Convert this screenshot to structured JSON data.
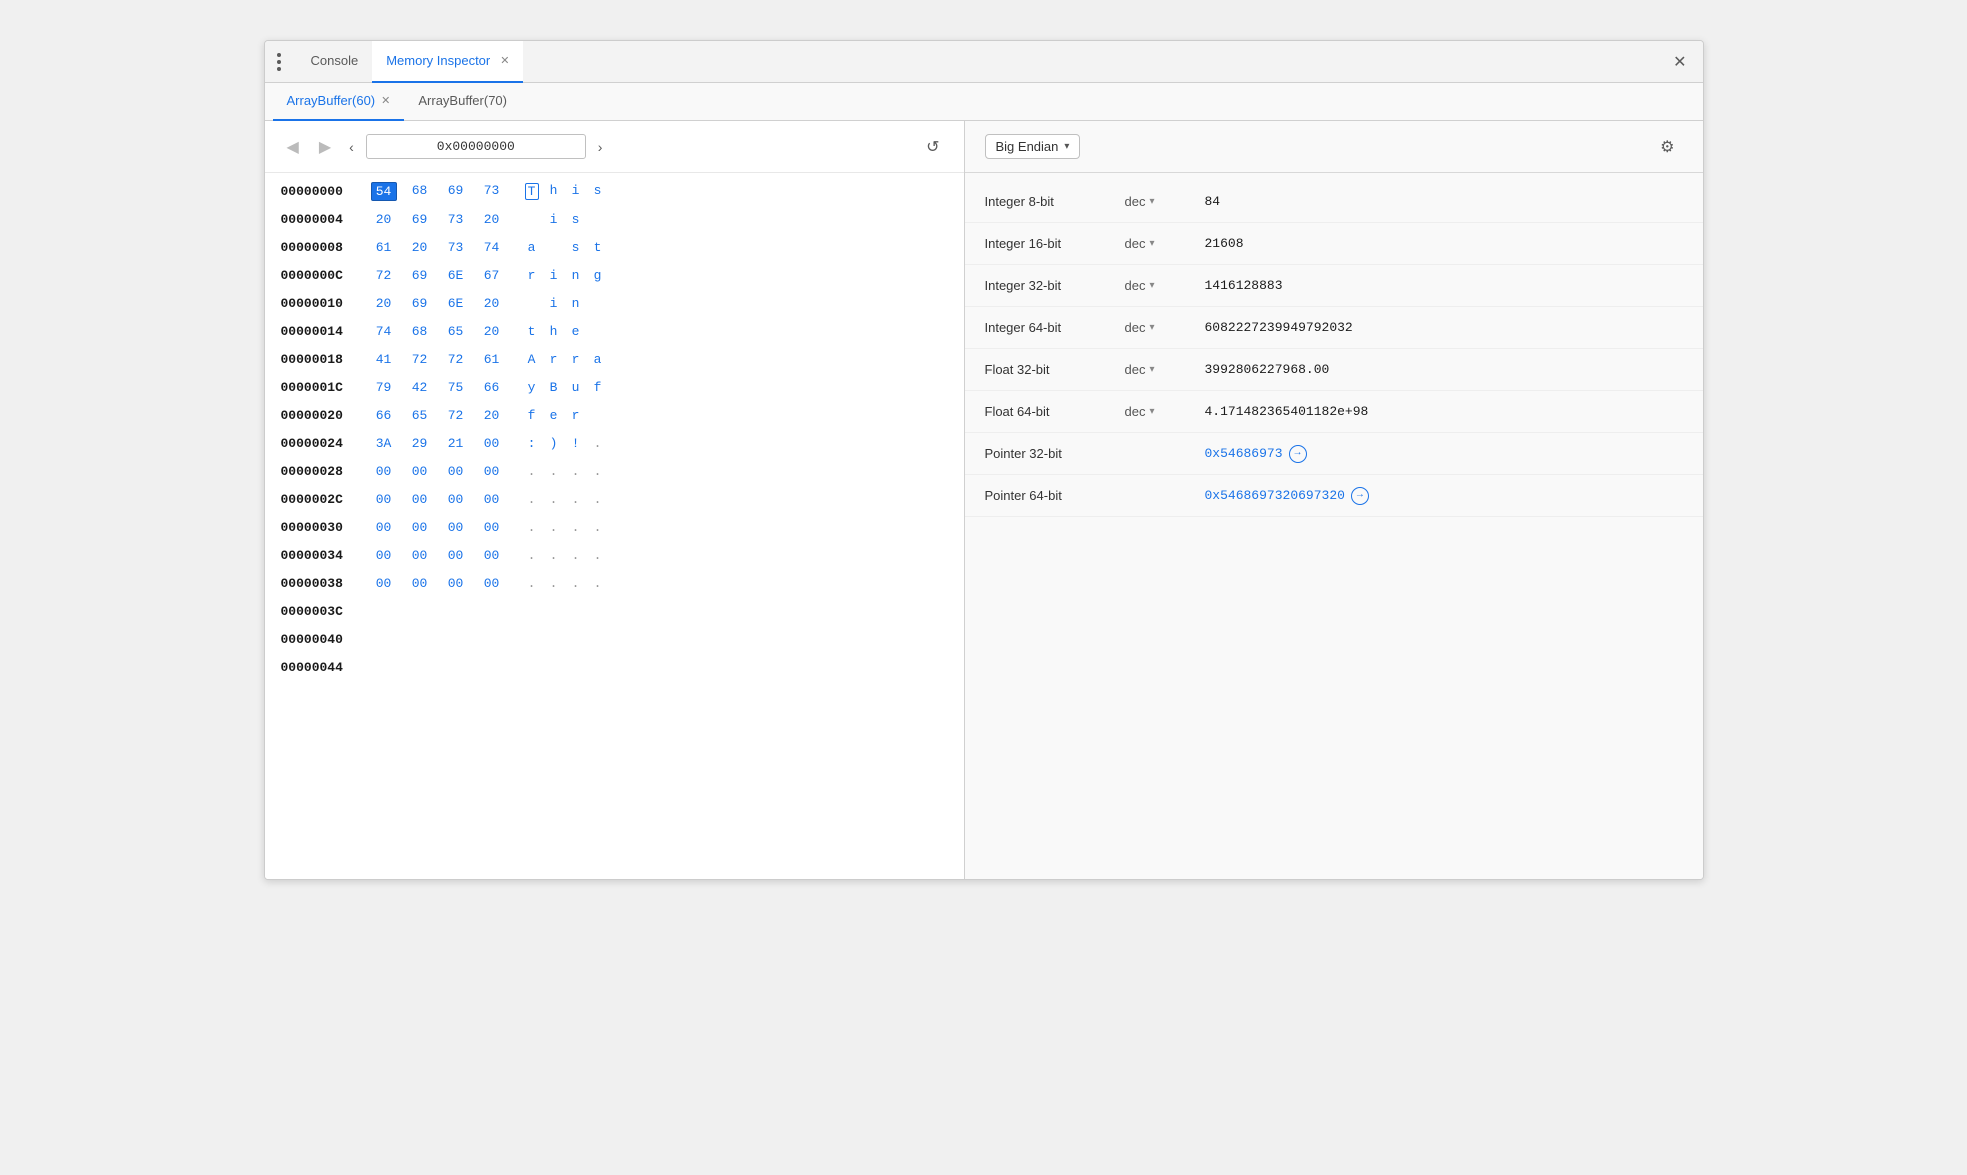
{
  "window": {
    "title": "Memory Inspector",
    "close_label": "✕"
  },
  "top_tabs": [
    {
      "id": "console",
      "label": "Console",
      "active": false,
      "closable": false
    },
    {
      "id": "memory-inspector",
      "label": "Memory Inspector",
      "active": true,
      "closable": true
    }
  ],
  "sub_tabs": [
    {
      "id": "arraybuffer-60",
      "label": "ArrayBuffer(60)",
      "active": true,
      "closable": true
    },
    {
      "id": "arraybuffer-70",
      "label": "ArrayBuffer(70)",
      "active": false,
      "closable": false
    }
  ],
  "nav": {
    "address": "0x00000000",
    "back_label": "◀",
    "forward_label": "▶",
    "left_arrow": "‹",
    "right_arrow": "›",
    "refresh_label": "↺"
  },
  "memory_rows": [
    {
      "addr": "00000000",
      "hex": [
        "54",
        "68",
        "69",
        "73"
      ],
      "ascii": [
        "T",
        "h",
        "i",
        "s"
      ],
      "selected_hex": 0,
      "selected_ascii": 0
    },
    {
      "addr": "00000004",
      "hex": [
        "20",
        "69",
        "73",
        "20"
      ],
      "ascii": [
        " ",
        "i",
        "s",
        " "
      ]
    },
    {
      "addr": "00000008",
      "hex": [
        "61",
        "20",
        "73",
        "74"
      ],
      "ascii": [
        "a",
        " ",
        "s",
        "t"
      ]
    },
    {
      "addr": "0000000C",
      "hex": [
        "72",
        "69",
        "6E",
        "67"
      ],
      "ascii": [
        "r",
        "i",
        "n",
        "g"
      ]
    },
    {
      "addr": "00000010",
      "hex": [
        "20",
        "69",
        "6E",
        "20"
      ],
      "ascii": [
        " ",
        "i",
        "n",
        " "
      ]
    },
    {
      "addr": "00000014",
      "hex": [
        "74",
        "68",
        "65",
        "20"
      ],
      "ascii": [
        "t",
        "h",
        "e",
        " "
      ]
    },
    {
      "addr": "00000018",
      "hex": [
        "41",
        "72",
        "72",
        "61"
      ],
      "ascii": [
        "A",
        "r",
        "r",
        "a"
      ]
    },
    {
      "addr": "0000001C",
      "hex": [
        "79",
        "42",
        "75",
        "66"
      ],
      "ascii": [
        "y",
        "B",
        "u",
        "f"
      ]
    },
    {
      "addr": "00000020",
      "hex": [
        "66",
        "65",
        "72",
        "20"
      ],
      "ascii": [
        "f",
        "e",
        "r",
        " "
      ]
    },
    {
      "addr": "00000024",
      "hex": [
        "3A",
        "29",
        "21",
        "00"
      ],
      "ascii": [
        ":",
        ")",
        "!",
        "."
      ]
    },
    {
      "addr": "00000028",
      "hex": [
        "00",
        "00",
        "00",
        "00"
      ],
      "ascii": [
        ".",
        ".",
        ".",
        "."
      ]
    },
    {
      "addr": "0000002C",
      "hex": [
        "00",
        "00",
        "00",
        "00"
      ],
      "ascii": [
        ".",
        ".",
        ".",
        "."
      ]
    },
    {
      "addr": "00000030",
      "hex": [
        "00",
        "00",
        "00",
        "00"
      ],
      "ascii": [
        ".",
        ".",
        ".",
        "."
      ]
    },
    {
      "addr": "00000034",
      "hex": [
        "00",
        "00",
        "00",
        "00"
      ],
      "ascii": [
        ".",
        ".",
        ".",
        "."
      ]
    },
    {
      "addr": "00000038",
      "hex": [
        "00",
        "00",
        "00",
        "00"
      ],
      "ascii": [
        ".",
        ".",
        ".",
        "."
      ]
    },
    {
      "addr": "0000003C",
      "hex": [],
      "ascii": []
    },
    {
      "addr": "00000040",
      "hex": [],
      "ascii": []
    },
    {
      "addr": "00000044",
      "hex": [],
      "ascii": []
    }
  ],
  "inspector": {
    "endian": "Big Endian",
    "endian_arrow": "▾",
    "gear_label": "⚙",
    "rows": [
      {
        "id": "int8",
        "label": "Integer 8-bit",
        "format": "dec",
        "has_arrow": true,
        "value": "84"
      },
      {
        "id": "int16",
        "label": "Integer 16-bit",
        "format": "dec",
        "has_arrow": true,
        "value": "21608"
      },
      {
        "id": "int32",
        "label": "Integer 32-bit",
        "format": "dec",
        "has_arrow": true,
        "value": "1416128883"
      },
      {
        "id": "int64",
        "label": "Integer 64-bit",
        "format": "dec",
        "has_arrow": true,
        "value": "6082227239949792032"
      },
      {
        "id": "float32",
        "label": "Float 32-bit",
        "format": "dec",
        "has_arrow": true,
        "value": "3992806227968.00"
      },
      {
        "id": "float64",
        "label": "Float 64-bit",
        "format": "dec",
        "has_arrow": true,
        "value": "4.171482365401182e+98"
      },
      {
        "id": "ptr32",
        "label": "Pointer 32-bit",
        "format": "",
        "has_arrow": false,
        "value": "0x54686973",
        "is_link": true
      },
      {
        "id": "ptr64",
        "label": "Pointer 64-bit",
        "format": "",
        "has_arrow": false,
        "value": "0x5468697320697320",
        "is_link": true
      }
    ]
  }
}
